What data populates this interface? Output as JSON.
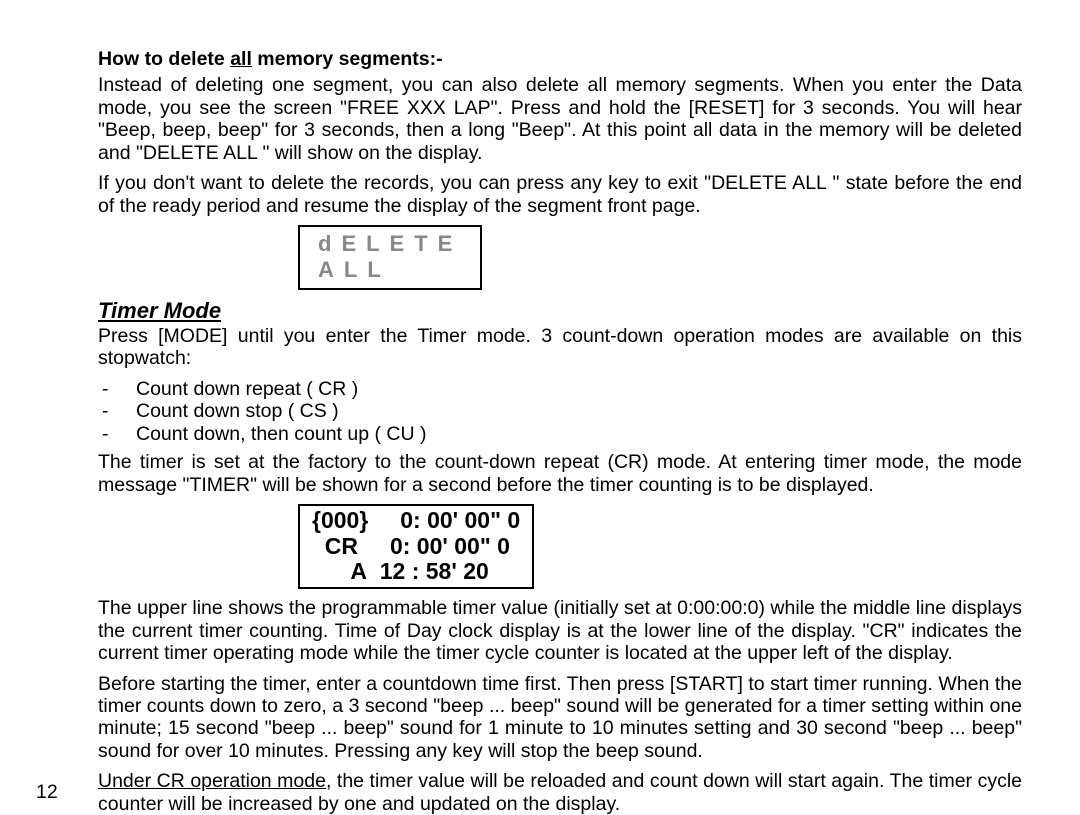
{
  "pageNumber": "12",
  "heading1_pre": "How to delete ",
  "heading1_u": "all",
  "heading1_post": " memory segments:-",
  "p1": "Instead of deleting one segment, you can also delete all memory segments.  When you enter the Data mode, you see the screen \"FREE XXX LAP\". Press and hold the [RESET] for 3 seconds. You will hear \"Beep, beep, beep\" for 3 seconds, then a long \"Beep\". At this point all data in the memory will be deleted and \"DELETE ALL \" will show on the display.",
  "p2": "If you don't want to delete the records, you can press any key to exit \"DELETE ALL \" state before the end of the ready period and resume the display of the segment front page.",
  "display_delete_l1": "dELETE",
  "display_delete_l2": "ALL",
  "section_timer": "Timer Mode",
  "p3": "Press [MODE] until you enter the Timer mode. 3 count-down operation modes are available on this stopwatch:",
  "list": {
    "i0": "Count down repeat ( CR )",
    "i1": "Count down stop ( CS )",
    "i2": "Count down, then count up ( CU )"
  },
  "p4": "The timer is set at the factory to the count-down repeat (CR) mode.  At entering timer mode, the mode message \"TIMER\" will be shown for a second before the timer counting is to be displayed.",
  "display_timer_l1": "{000}     0: 00' 00\" 0",
  "display_timer_l2": "  CR     0: 00' 00\" 0",
  "display_timer_l3": "      A  12 : 58' 20",
  "p5": "The upper line shows the programmable timer value (initially set at 0:00:00:0) while the middle line displays the current timer counting.  Time of Day clock display is at the lower line of the display. \"CR\" indicates the current timer operating mode while the timer cycle counter is located at the upper left of the display.",
  "p6": "Before starting the timer, enter a countdown time first.  Then press [START] to start timer running. When the timer counts down to zero, a 3 second \"beep ... beep\" sound will be generated for a timer setting within one minute; 15 second \"beep ... beep\" sound for 1 minute to 10 minutes setting and 30 second \"beep ... beep\" sound for over 10 minutes.  Pressing any key will stop the beep sound.",
  "p7_u": "Under CR operation mode",
  "p7_rest": ", the timer value will be reloaded and count down will start again.  The timer cycle counter will be increased by one and updated on the display."
}
